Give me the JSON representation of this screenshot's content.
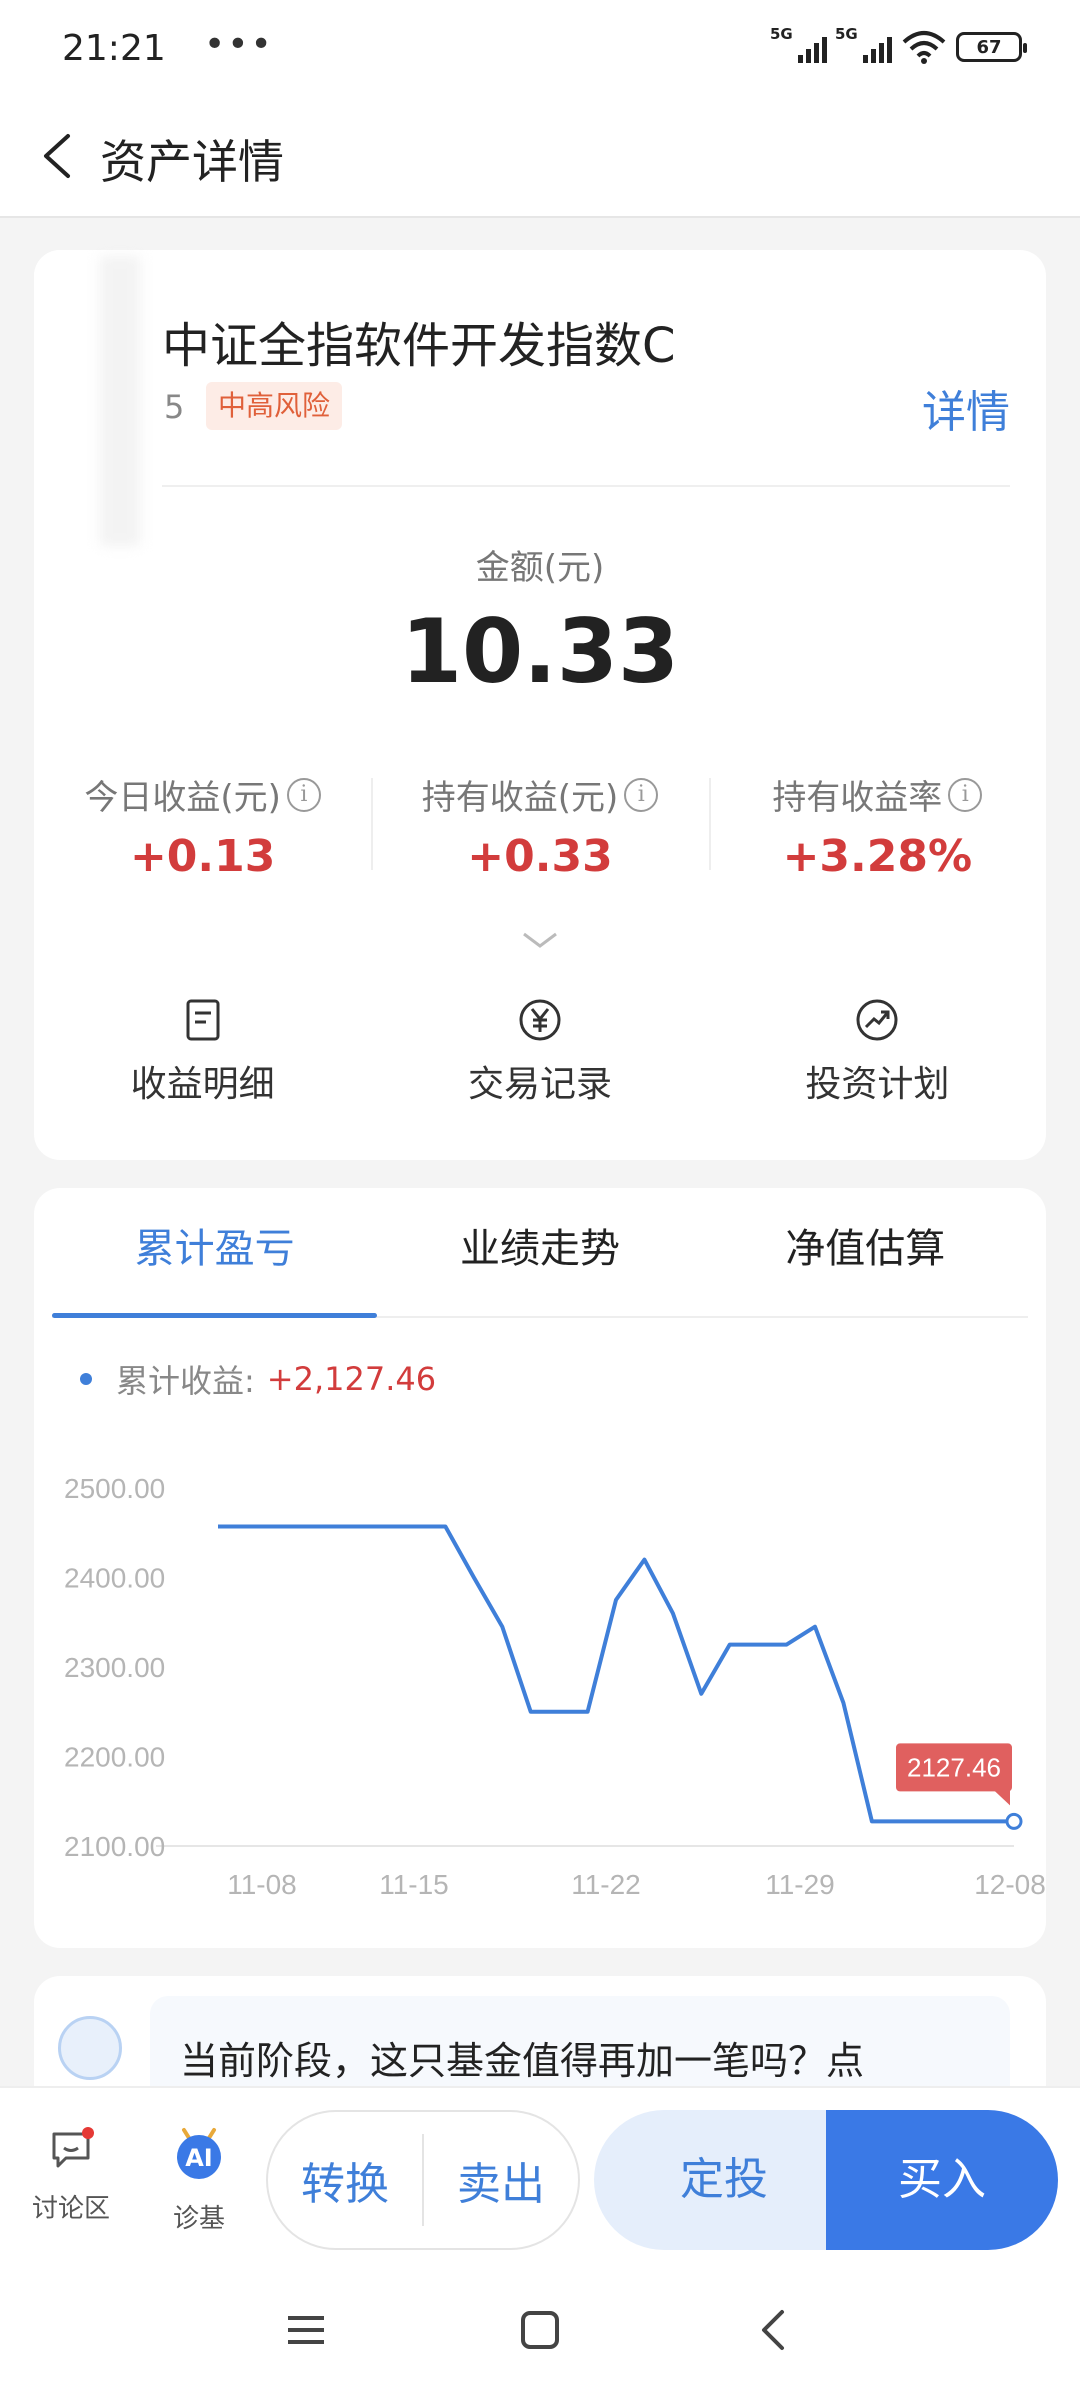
{
  "status_bar": {
    "time": "21:21",
    "dots": "•••",
    "signal1": "5G",
    "signal2": "5G",
    "battery": "67"
  },
  "header": {
    "title": "资产详情"
  },
  "fund": {
    "name": "中证全指软件开发指数C",
    "code_fragment": "5",
    "risk": "中高风险",
    "detail_link": "详情",
    "amount_label": "金额(元)",
    "amount": "10.33",
    "stats": [
      {
        "label": "今日收益(元)",
        "value": "+0.13"
      },
      {
        "label": "持有收益(元)",
        "value": "+0.33"
      },
      {
        "label": "持有收益率",
        "value": "+3.28%"
      }
    ],
    "actions": [
      {
        "label": "收益明细",
        "icon": "document-icon"
      },
      {
        "label": "交易记录",
        "icon": "yen-circle-icon"
      },
      {
        "label": "投资计划",
        "icon": "trend-icon"
      }
    ]
  },
  "tabs": [
    "累计盈亏",
    "业绩走势",
    "净值估算"
  ],
  "legend": {
    "label": "累计收益:",
    "value": "+2,127.46"
  },
  "chart_data": {
    "type": "line",
    "x": [
      "11-07",
      "11-08",
      "11-11",
      "11-12",
      "11-13",
      "11-14",
      "11-15",
      "11-18",
      "11-19",
      "11-20",
      "11-21",
      "11-22",
      "11-25",
      "11-26",
      "11-27",
      "11-28",
      "11-29",
      "12-02",
      "12-03",
      "12-04",
      "12-05",
      "12-06",
      "12-08"
    ],
    "series": [
      {
        "values": [
          2457,
          2457,
          2457,
          2457,
          2457,
          2457,
          2457,
          2457,
          2457,
          2400,
          2345,
          2250,
          2250,
          2250,
          2375,
          2420,
          2360,
          2270,
          2325,
          2325,
          2325,
          2345,
          2260,
          2127.46,
          2127.46,
          2127.46,
          2127.46,
          2127.46,
          2127.46
        ]
      }
    ],
    "x_ticks": [
      "11-08",
      "11-15",
      "11-22",
      "11-29",
      "12-08"
    ],
    "y_ticks": [
      "2500.00",
      "2400.00",
      "2300.00",
      "2200.00",
      "2100.00"
    ],
    "ylim": [
      2100,
      2500
    ],
    "last_label": "2127.46",
    "colors": {
      "line": "#3f7fd9",
      "label_bg": "#e0605f"
    }
  },
  "ai_banner": {
    "text": "当前阶段，这只基金值得再加一笔吗？点"
  },
  "bottom_bar": {
    "discuss": "讨论区",
    "diagnose": "诊基",
    "ai_badge": "AI",
    "convert": "转换",
    "sell": "卖出",
    "auto_invest": "定投",
    "buy": "买入"
  }
}
